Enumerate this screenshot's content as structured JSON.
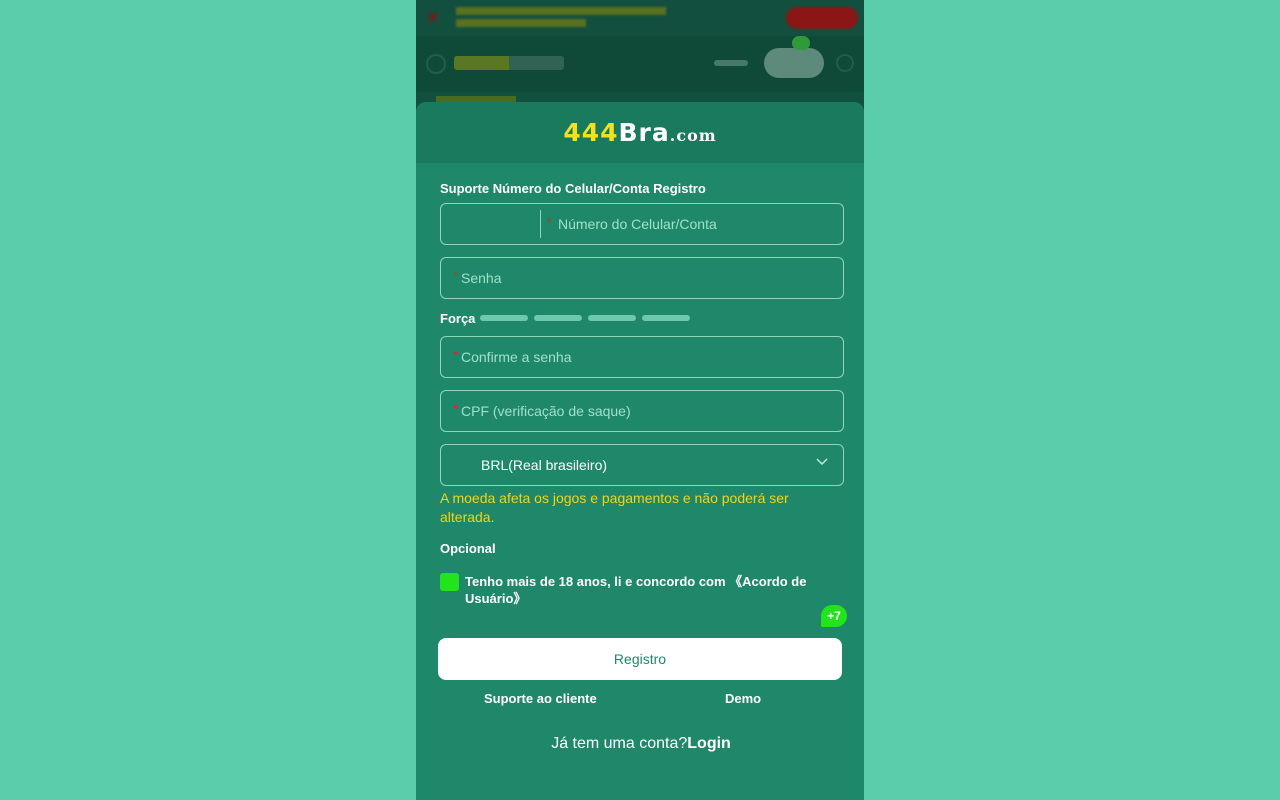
{
  "logo": {
    "digits": "444",
    "brand": "Bra",
    "suffix": ".com"
  },
  "form": {
    "section_label": "Suporte Número do Celular/Conta Registro",
    "required_mark": "*",
    "phone_placeholder": "Número do Celular/Conta",
    "password_placeholder": "Senha",
    "strength_label": "Força",
    "confirm_placeholder": "Confirme a senha",
    "cpf_placeholder": "CPF (verificação de saque)",
    "currency_value": "BRL(Real brasileiro)",
    "currency_warning": "A moeda afeta os jogos e pagamentos e não poderá ser alterada.",
    "optional_label": "Opcional",
    "agreement_text": "Tenho mais de 18 anos, li e concordo com",
    "agreement_link": "《Acordo de Usuário》",
    "agreement_checked": true,
    "register_button": "Registro"
  },
  "chat_badge": "+7",
  "links": {
    "support": "Suporte ao cliente",
    "demo": "Demo"
  },
  "login_prompt": {
    "text": "Já tem uma conta?",
    "link": "Login"
  },
  "colors": {
    "background": "#5ccdab",
    "modal": "#1f886b",
    "accent_green": "#22e41c",
    "warning": "#f5d40f",
    "required": "#e0242b"
  }
}
